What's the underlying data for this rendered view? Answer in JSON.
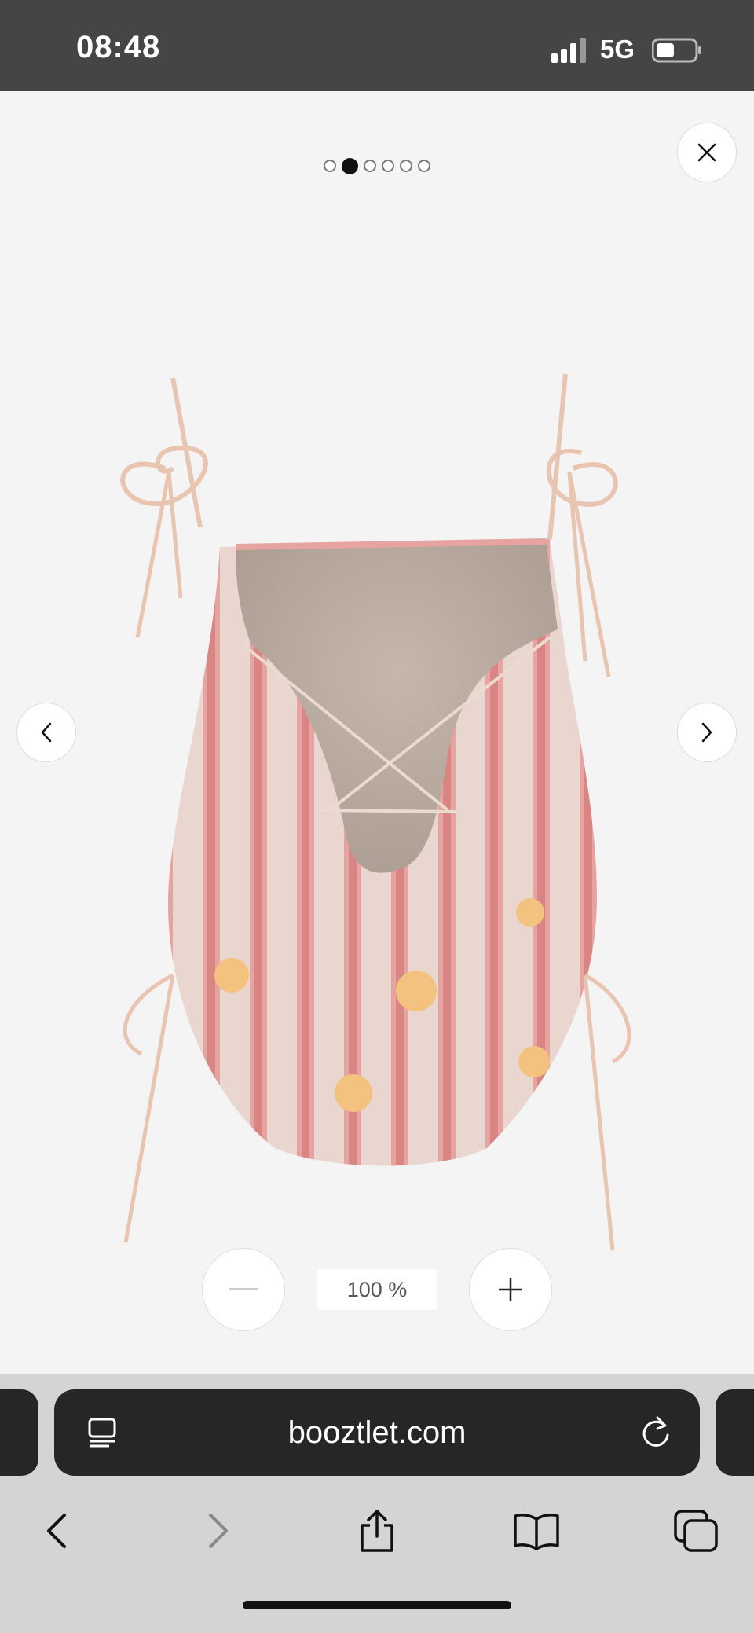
{
  "status_bar": {
    "time": "08:48",
    "network": "5G"
  },
  "viewer": {
    "image_count": 6,
    "active_index": 1,
    "zoom_level": "100 %",
    "product_alt": "Patterned one-piece swimsuit, back view",
    "icons": {
      "close": "close-icon",
      "prev": "chevron-left-icon",
      "next": "chevron-right-icon",
      "zoom_out": "minus-icon",
      "zoom_in": "plus-icon"
    }
  },
  "browser": {
    "url": "booztlet.com",
    "toolbar": [
      "back-icon",
      "forward-icon",
      "share-icon",
      "bookmarks-icon",
      "tabs-icon"
    ]
  }
}
